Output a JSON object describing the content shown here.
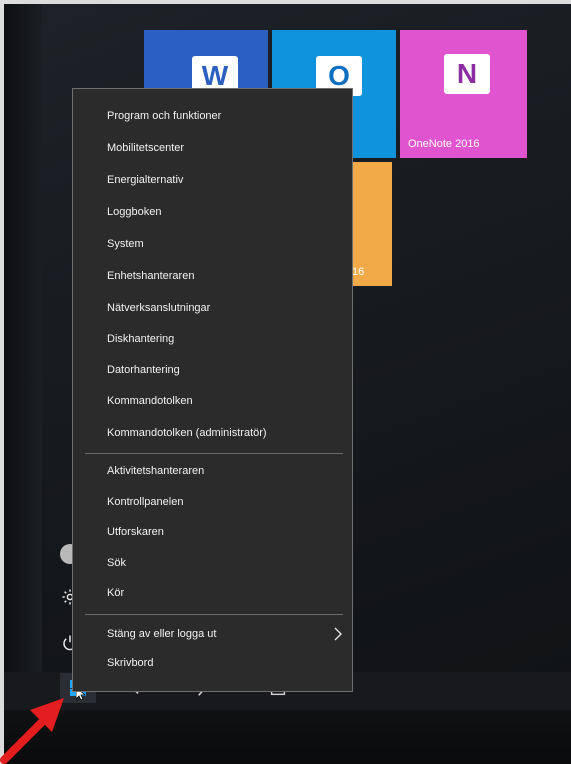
{
  "tiles": {
    "word_glyph": "W",
    "outlook_glyph": "O",
    "onenote_glyph": "N",
    "onenote_label": "OneNote 2016",
    "orange_fragment": "16"
  },
  "context_menu": {
    "group1": [
      "Program och funktioner",
      "Mobilitetscenter",
      "Energialternativ",
      "Loggboken",
      "System",
      "Enhetshanteraren",
      "Nätverksanslutningar",
      "Diskhantering",
      "Datorhantering",
      "Kommandotolken",
      "Kommandotolken (administratör)"
    ],
    "group2": [
      "Aktivitetshanteraren",
      "Kontrollpanelen",
      "Utforskaren",
      "Sök",
      "Kör"
    ],
    "shutdown": "Stäng av eller logga ut",
    "desktop": "Skrivbord"
  },
  "colors": {
    "word": "#2b5fc0",
    "outlook": "#0f93dd",
    "onenote": "#e055cf",
    "orange_tile": "#f2a948",
    "menu_bg": "#2b2b2b",
    "start_accent": "#1ea7ff",
    "arrow": "#e41e1e"
  },
  "icons": {
    "rail": [
      "user-avatar-icon",
      "settings-gear-icon",
      "power-icon",
      "windows-start-icon"
    ],
    "taskbar": [
      "back-arrow-icon",
      "search-icon",
      "task-view-icon"
    ],
    "menu_submenu": "chevron-right-icon",
    "pointer": "mouse-cursor-icon",
    "annotation": "red-arrow-icon"
  }
}
